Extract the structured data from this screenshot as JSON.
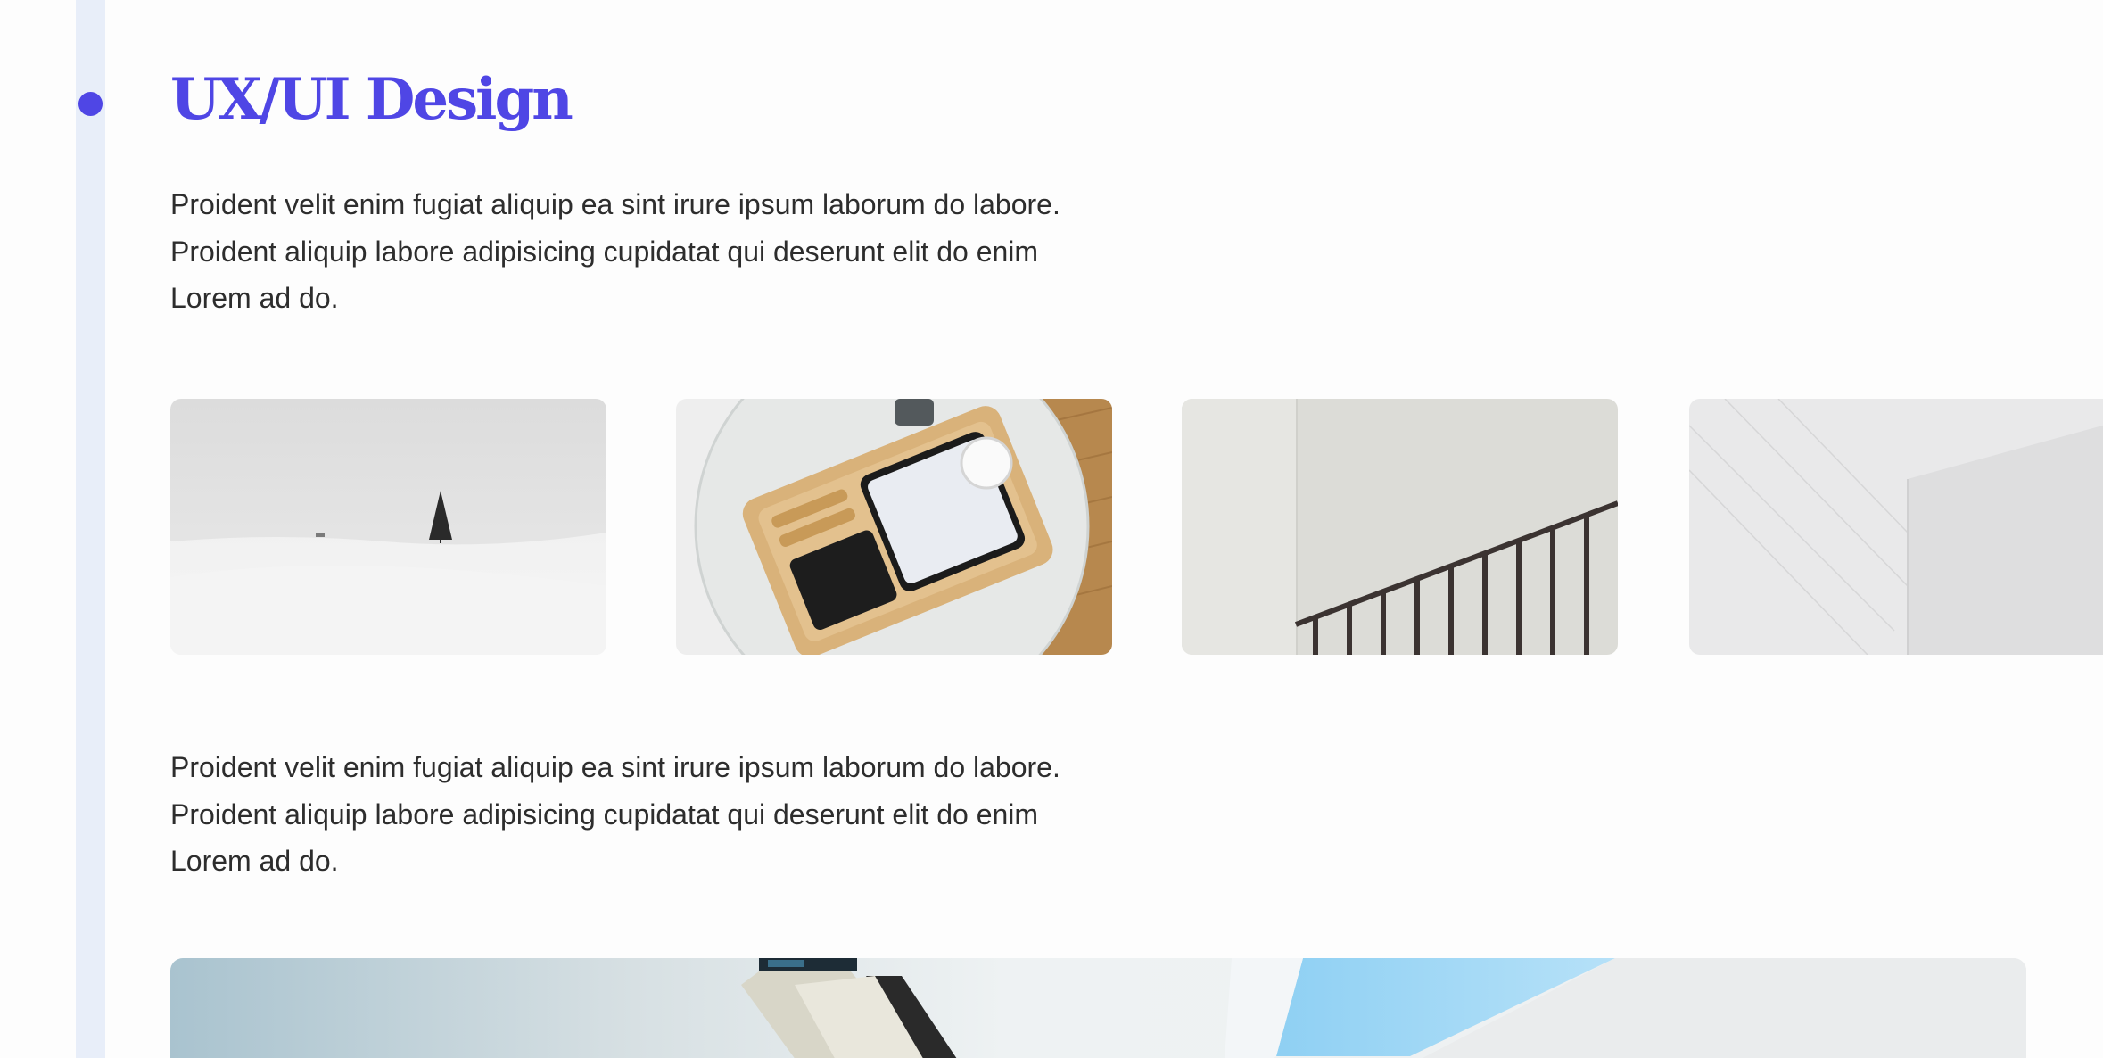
{
  "section": {
    "title": "UX/UI Design",
    "paragraph_1": "Proident velit enim fugiat aliquip ea sint irure ipsum laborum do labore. Proident aliquip labore adipisicing cupidatat qui deserunt elit do enim Lorem ad do.",
    "paragraph_2": "Proident velit enim fugiat aliquip ea sint irure ipsum laborum do labore. Proident aliquip labore adipisicing cupidatat qui deserunt elit do enim Lorem ad do."
  },
  "gallery": {
    "images": [
      {
        "name": "snow-field-tree-image"
      },
      {
        "name": "desk-organizer-tray-image"
      },
      {
        "name": "stair-railing-image"
      },
      {
        "name": "white-wall-architecture-image"
      }
    ]
  },
  "hero": {
    "name": "architecture-sky-hero-image"
  },
  "colors": {
    "accent": "#4f46e5",
    "rail": "#e8eef9",
    "text": "#2d2d2d",
    "background": "#fdfdfd"
  }
}
